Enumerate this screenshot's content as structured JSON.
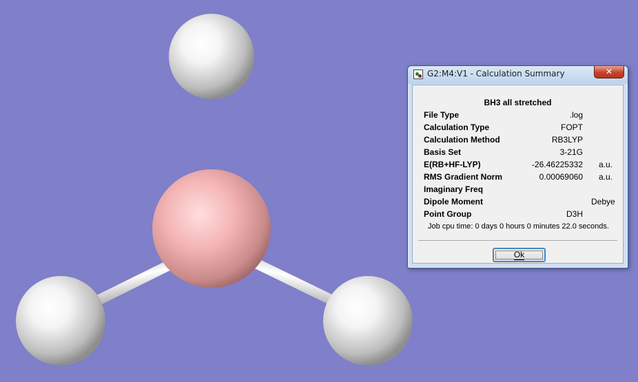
{
  "viewer": {
    "background_color": "#7f7fca",
    "molecule": {
      "atoms": [
        {
          "element": "B",
          "color": "#f2b6b6"
        },
        {
          "element": "H",
          "color": "#ffffff"
        },
        {
          "element": "H",
          "color": "#ffffff"
        },
        {
          "element": "H",
          "color": "#ffffff"
        }
      ],
      "bond_color": "#e6e6e6"
    }
  },
  "dialog": {
    "title": "G2:M4:V1 - Calculation Summary",
    "close_glyph": "✕",
    "summary_title": "BH3 all stretched",
    "rows": [
      {
        "label": "File Type",
        "value": ".log",
        "unit": ""
      },
      {
        "label": "Calculation Type",
        "value": "FOPT",
        "unit": ""
      },
      {
        "label": "Calculation Method",
        "value": "RB3LYP",
        "unit": ""
      },
      {
        "label": "Basis Set",
        "value": "3-21G",
        "unit": ""
      },
      {
        "label": "E(RB+HF-LYP)",
        "value": "-26.46225332",
        "unit": "a.u."
      },
      {
        "label": "RMS Gradient Norm",
        "value": "0.00069060",
        "unit": "a.u."
      },
      {
        "label": "Imaginary Freq",
        "value": "",
        "unit": ""
      },
      {
        "label": "Dipole Moment",
        "value": "",
        "unit": "Debye"
      },
      {
        "label": "Point Group",
        "value": "D3H",
        "unit": ""
      }
    ],
    "cpu_time": "Job cpu time:  0 days  0 hours  0 minutes 22.0 seconds.",
    "ok_label": "Ok"
  }
}
